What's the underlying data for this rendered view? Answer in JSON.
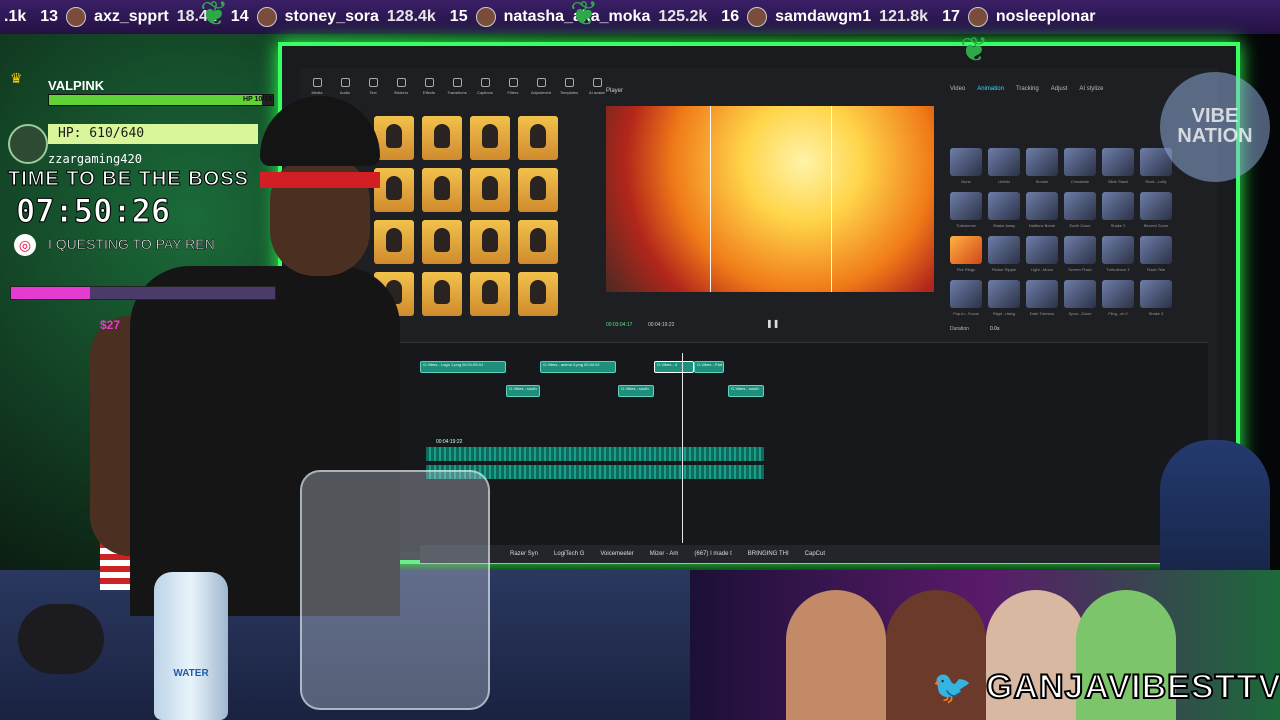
{
  "leaderboard": [
    {
      "rank": "",
      "name": ".1k",
      "score": ""
    },
    {
      "rank": "13",
      "name": "axz_spprt",
      "score": "18.4k"
    },
    {
      "rank": "14",
      "name": "stoney_sora",
      "score": "128.4k"
    },
    {
      "rank": "15",
      "name": "natasha_aka_moka",
      "score": "125.2k"
    },
    {
      "rank": "16",
      "name": "samdawgm1",
      "score": "121.8k"
    },
    {
      "rank": "17",
      "name": "nosleeplonar",
      "score": ""
    }
  ],
  "hud": {
    "player_name": "VALPINK",
    "hp_tag": "HP 10/10",
    "hp_text": "HP: 610/640",
    "hp_fraction": 0.95,
    "username": "zzargaming420",
    "title": "TIME TO BE THE BOSS",
    "timer": "07:50:26",
    "quest": "I QUESTING TO PAY REN",
    "progress_fraction": 0.3,
    "amount": "$27"
  },
  "editor": {
    "toolbar": [
      "Media",
      "Audio",
      "Text",
      "Stickers",
      "Effects",
      "Transitions",
      "Captions",
      "Filters",
      "Adjustment",
      "Templates",
      "AI avatar"
    ],
    "thumbnails": [
      {
        "label": ""
      },
      {
        "label": "B&W Comic 2"
      },
      {
        "label": "Sketch"
      },
      {
        "label": "Anime Realistic"
      },
      {
        "label": ""
      },
      {
        "label": "Super Line"
      },
      {
        "label": "Pinball"
      },
      {
        "label": "Action Pencil"
      },
      {
        "label": "Quick Math"
      },
      {
        "label": "Birds"
      },
      {
        "label": "Flames"
      },
      {
        "label": "Mosaic"
      },
      {
        "label": "B&W Comic"
      },
      {
        "label": "Dramatic Anime"
      },
      {
        "label": "OH"
      },
      {
        "label": "Pop"
      }
    ],
    "player": {
      "label": "Player",
      "time_current": "00:03:04:17",
      "time_total": "00:04:19:22"
    },
    "panel_tabs": [
      "Video",
      "Animation",
      "Tracking",
      "Adjust",
      "AI stylize"
    ],
    "panel_active": "Animation",
    "effects": [
      "None",
      "Unfold",
      "Smoke",
      "Crossfade",
      "Slide Stack",
      "Rock...Lofty",
      "Turbulence",
      "Shake Away",
      "Halftone Bomb",
      "Earth Zoom",
      "Shake 2",
      "Blurred Zoom",
      "Fire Rings",
      "Flicker Ripple",
      "Light...Mono",
      "Screen Flash",
      "Turbulence 4",
      "Flash Tele",
      "Pop-in...Focus",
      "Rippl...rising",
      "Dark Tremors",
      "Spoo...Zoom",
      "Fling...ch 2",
      "Shake 3"
    ],
    "duration_label": "Duration",
    "duration_value": "0.0s",
    "clips": [
      "G-Vibes - Logo 1.png  00:01:05:01",
      "G-Vibes - anima 4.png  00:00:02",
      "G-Vibes - 4",
      "G-Vibes - Part",
      "G-Vibes - south",
      "G-Vibes - south",
      "G-Vibes - south"
    ],
    "audio_time": "00:04:19:22"
  },
  "taskbar": [
    "Razer Syn",
    "LogiTech G",
    "Voicemeeter",
    "Mizer - Am",
    "(667) I made t",
    "BRINGING THI",
    "CapCut"
  ],
  "bottle_label": "WATER",
  "vibe_logo": "VIBE NATION",
  "banner_title": "GANJAVIBESTTV"
}
